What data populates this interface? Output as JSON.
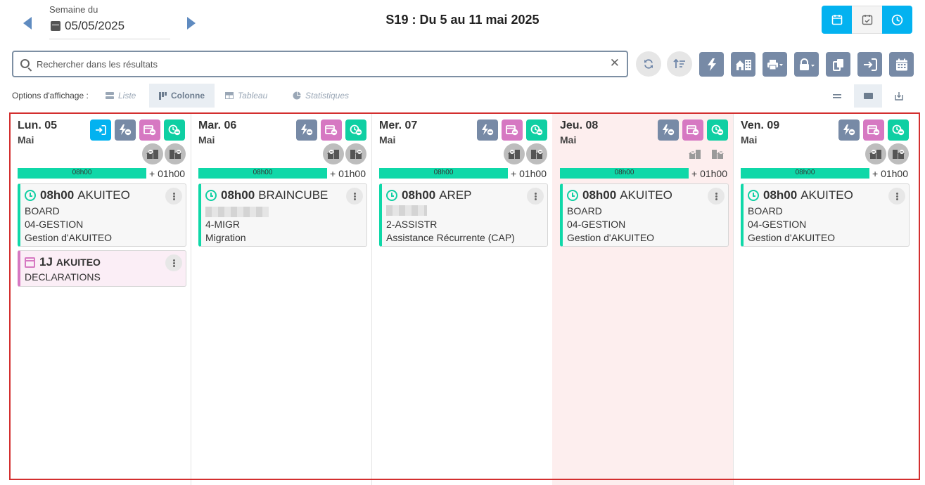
{
  "header": {
    "week_label": "Semaine du",
    "week_date": "05/05/2025",
    "title": "S19 : Du 5 au 11 mai 2025",
    "view_modes": [
      {
        "icon": "calendar-icon",
        "active": true
      },
      {
        "icon": "calendar-check-icon",
        "active": false
      },
      {
        "icon": "clock-icon",
        "active": true
      }
    ]
  },
  "search": {
    "placeholder": "Rechercher dans les résultats",
    "value": "",
    "clear_label": "✕"
  },
  "toolbar": {
    "icons": [
      "refresh-icon",
      "sort-icon",
      "bolt-icon",
      "home-building-icon",
      "print-icon",
      "lock-icon",
      "copy-icon",
      "sign-in-icon",
      "calendar-grid-icon"
    ]
  },
  "display_options": {
    "label": "Options d'affichage :",
    "items": [
      {
        "label": "Liste",
        "icon": "list-icon",
        "active": false
      },
      {
        "label": "Colonne",
        "icon": "column-icon",
        "active": true
      },
      {
        "label": "Tableau",
        "icon": "table-icon",
        "active": false
      },
      {
        "label": "Statistiques",
        "icon": "pie-chart-icon",
        "active": false
      }
    ]
  },
  "colors": {
    "accent_blue": "#03b2f0",
    "slate": "#778aa6",
    "pink": "#d678c2",
    "green": "#0fcfa3",
    "highlight_day": "#fdeeee",
    "frame": "#d32f2f"
  },
  "days": [
    {
      "name": "Lun. 05",
      "month": "Mai",
      "progress_label": "08h00",
      "extra": "+ 01h00",
      "highlight": false,
      "cards": [
        {
          "type": "time",
          "time": "08h00",
          "client": "AKUITEO",
          "lines": [
            "BOARD",
            "04-GESTION",
            "Gestion d'AKUITEO"
          ],
          "blurred": false
        },
        {
          "type": "day",
          "time": "1J",
          "client": "AKUITEO",
          "lines": [
            "DECLARATIONS"
          ],
          "blurred": false
        }
      ]
    },
    {
      "name": "Mar. 06",
      "month": "Mai",
      "progress_label": "08h00",
      "extra": "+ 01h00",
      "highlight": false,
      "cards": [
        {
          "type": "time",
          "time": "08h00",
          "client": "BRAINCUBE",
          "lines": [
            "4-MIGR",
            "Migration"
          ],
          "blurred": true
        }
      ]
    },
    {
      "name": "Mer. 07",
      "month": "Mai",
      "progress_label": "08h00",
      "extra": "+ 01h00",
      "highlight": false,
      "cards": [
        {
          "type": "time",
          "time": "08h00",
          "client": "AREP",
          "lines": [
            "2-ASSISTR",
            "Assistance Récurrente (CAP)"
          ],
          "blurred": true
        }
      ]
    },
    {
      "name": "Jeu. 08",
      "month": "Mai",
      "progress_label": "08h00",
      "extra": "+ 01h00",
      "highlight": true,
      "cards": [
        {
          "type": "time",
          "time": "08h00",
          "client": "AKUITEO",
          "lines": [
            "BOARD",
            "04-GESTION",
            "Gestion d'AKUITEO"
          ],
          "blurred": false
        }
      ]
    },
    {
      "name": "Ven. 09",
      "month": "Mai",
      "progress_label": "08h00",
      "extra": "+ 01h00",
      "highlight": false,
      "cards": [
        {
          "type": "time",
          "time": "08h00",
          "client": "AKUITEO",
          "lines": [
            "BOARD",
            "04-GESTION",
            "Gestion d'AKUITEO"
          ],
          "blurred": false
        }
      ]
    }
  ]
}
